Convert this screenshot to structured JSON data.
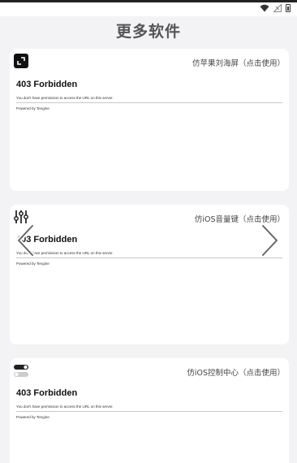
{
  "status_bar": {
    "icons": [
      "wifi-icon",
      "signal-icon",
      "battery-icon"
    ]
  },
  "page": {
    "title": "更多软件"
  },
  "cards": [
    {
      "icon": "fullscreen-icon",
      "link": "仿苹果刘海屏（点击使用）",
      "embed": {
        "heading": "403 Forbidden",
        "message": "You don't have permission to access the URL on this server.",
        "footer": "Powered by Tengine"
      }
    },
    {
      "icon": "sliders-icon",
      "link": "仿iOS音量键（点击使用）",
      "embed": {
        "heading": "403 Forbidden",
        "message": "You don't have permission to access the URL on this server.",
        "footer": "Powered by Tengine"
      }
    },
    {
      "icon": "toggles-icon",
      "link": "仿iOS控制中心（点击使用）",
      "embed": {
        "heading": "403 Forbidden",
        "message": "You don't have permission to access the URL on this server.",
        "footer": "Powered by Tengine"
      }
    }
  ],
  "carousel": {
    "prev_icon": "chevron-left-icon",
    "next_icon": "chevron-right-icon"
  }
}
